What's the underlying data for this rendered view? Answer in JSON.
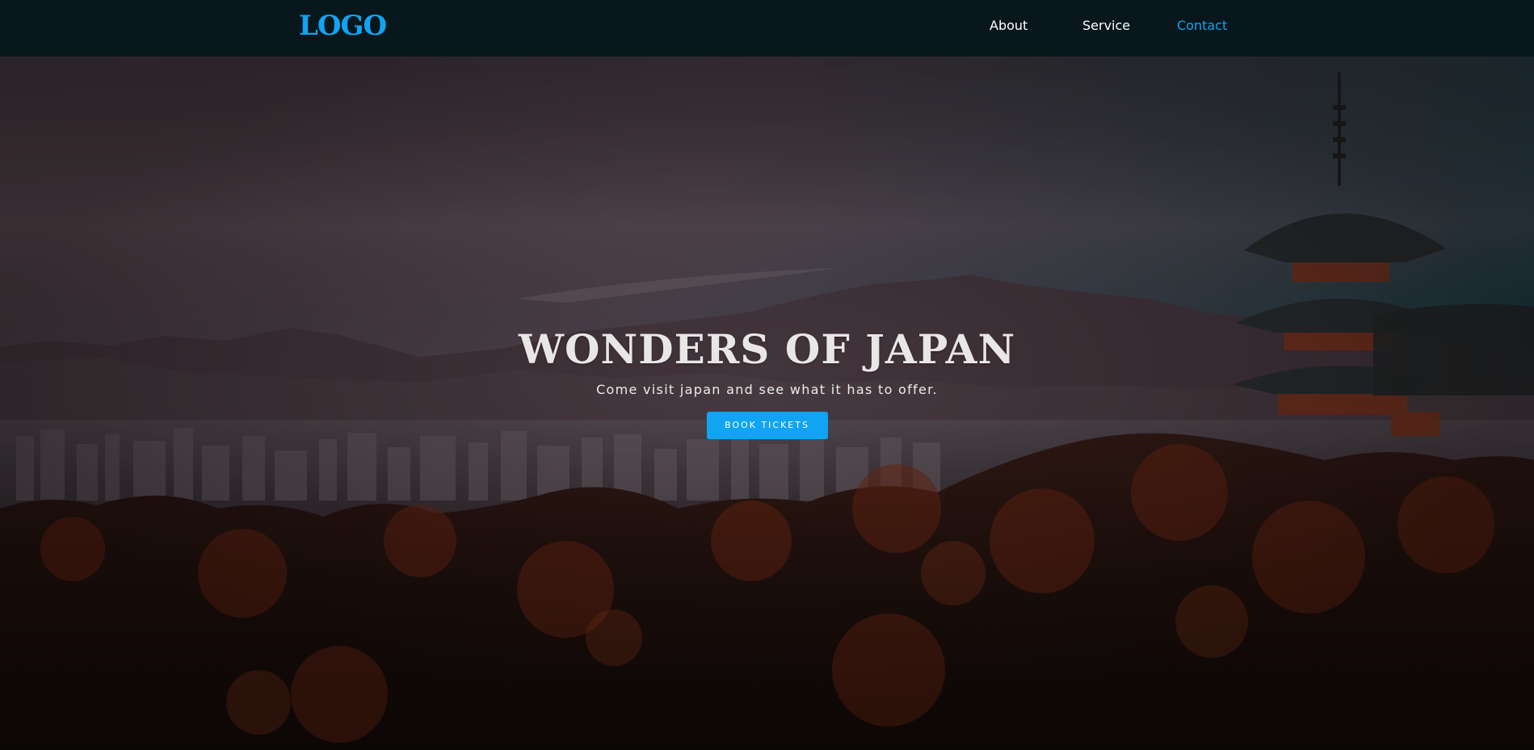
{
  "header": {
    "logo": "LOGO",
    "nav": [
      {
        "label": "About",
        "active": false
      },
      {
        "label": "Service",
        "active": false
      },
      {
        "label": "Contact",
        "active": true
      }
    ]
  },
  "hero": {
    "title": "WONDERS OF JAPAN",
    "subtitle": "Come visit japan and see what it has to offer.",
    "cta_label": "BOOK TICKETS",
    "background_description_icon": "kyoto-pagoda-cityscape-photo"
  },
  "colors": {
    "accent": "#10a4f2",
    "nav_background": "#08171b",
    "nav_text": "#ffffff",
    "hero_text": "#e9e6e6"
  }
}
